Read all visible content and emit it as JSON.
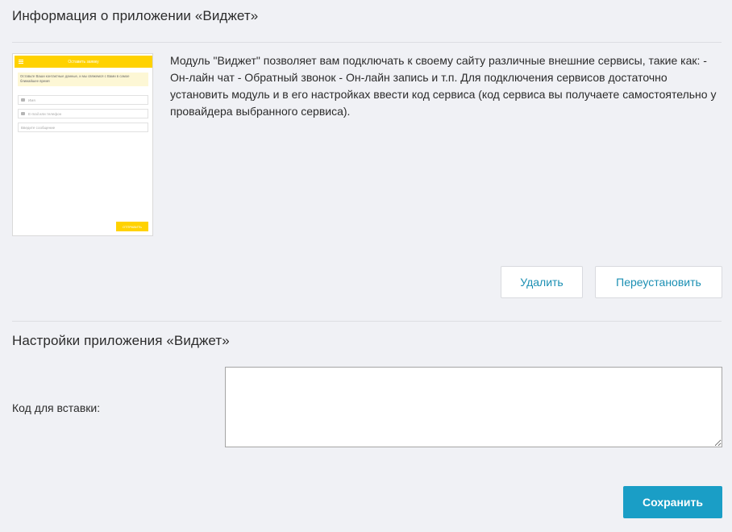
{
  "info_section": {
    "title": "Информация о приложении «Виджет»",
    "description": "Модуль \"Виджет\" позволяет вам подключать к своему сайту различные внешние сервисы, такие как: - Он-лайн чат - Обратный звонок - Он-лайн запись и т.п. Для подключения сервисов достаточно установить модуль и в его настройках ввести код сервиса (код сервиса вы получаете самостоятельно у провайдера выбранного сервиса)."
  },
  "preview": {
    "header_title": "Оставить заявку",
    "note": "Оставьте Ваши контактные данные, и мы свяжемся с Вами в самое ближайшее время",
    "fields": [
      {
        "placeholder": "Имя",
        "icon": "user-icon"
      },
      {
        "placeholder": "E-mail или телефон",
        "icon": "contact-card-icon"
      },
      {
        "placeholder": "Введите сообщение",
        "icon": ""
      }
    ],
    "send_label": "ОТПРАВИТЬ",
    "accent_color": "#ffd200"
  },
  "actions": {
    "delete_label": "Удалить",
    "reinstall_label": "Переустановить"
  },
  "settings_section": {
    "title": "Настройки приложения «Виджет»",
    "code_label": "Код для вставки:",
    "code_value": "",
    "save_label": "Сохранить"
  },
  "colors": {
    "background": "#f0f1f5",
    "link_text": "#1b8fb3",
    "primary_button": "#1a9ec6"
  }
}
